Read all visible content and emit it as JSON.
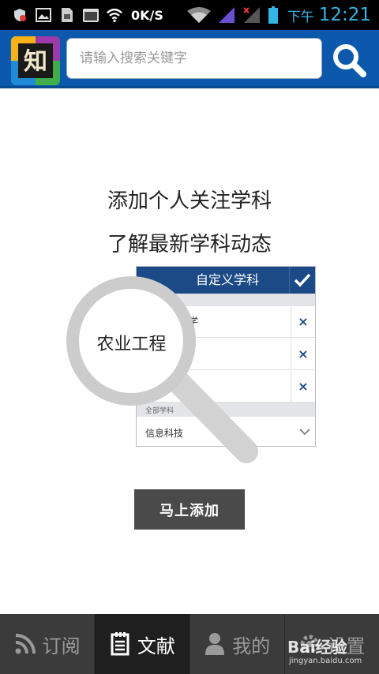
{
  "status_bar": {
    "speed": "0K/S",
    "am_pm": "下午",
    "time": "12:21",
    "icons": [
      "shield-notification-icon",
      "image-notification-icon",
      "sd-card-icon",
      "calendar-365-icon",
      "wifi-icon",
      "wifi-signal-icon",
      "cell-signal-icon",
      "cell-signal-nosim-icon",
      "battery-icon"
    ],
    "accent_color": "#34b5e5"
  },
  "header": {
    "logo_char": "知",
    "search_placeholder": "请输入搜索关键字",
    "bar_color": "#0b58ac"
  },
  "main": {
    "headline_1": "添加个人关注学科",
    "headline_2": "了解最新学科动态",
    "illustration": {
      "card_title": "自定义学科",
      "first_row_partial": "学",
      "remove_mark": "×",
      "section_label": "全部学科",
      "select_value": "信息科技",
      "lens_text": "农业工程"
    },
    "cta_label": "马上添加"
  },
  "bottom_nav": {
    "items": [
      {
        "label": "订阅",
        "icon": "rss-icon",
        "active": false
      },
      {
        "label": "文献",
        "icon": "document-icon",
        "active": true
      },
      {
        "label": "我的",
        "icon": "person-icon",
        "active": false
      },
      {
        "label": "设置",
        "icon": "gear-icon",
        "active": false
      }
    ]
  },
  "watermark": {
    "brand": "Bai经验",
    "url": "jingyan.baidu.com"
  }
}
